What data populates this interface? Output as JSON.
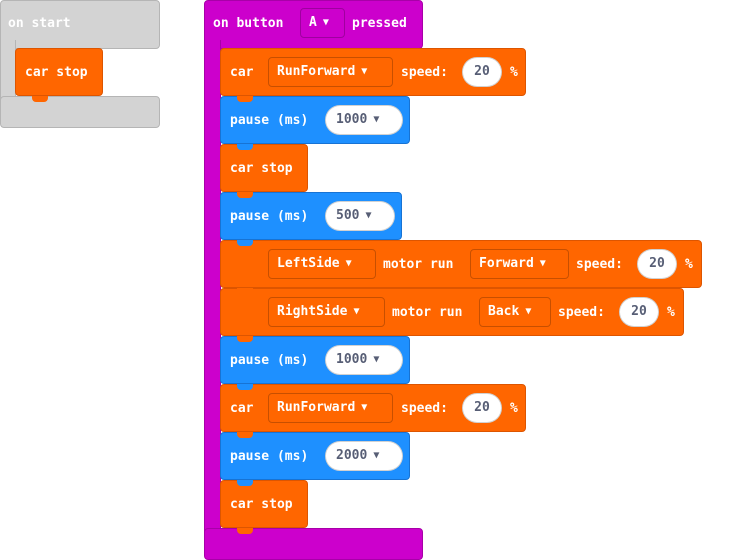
{
  "on_start": {
    "label": "on start",
    "blocks": [
      {
        "label": "car stop"
      }
    ]
  },
  "on_button": {
    "prefix": "on button",
    "button": "A",
    "suffix": "pressed"
  },
  "stack": {
    "b1": {
      "label": "car",
      "dropdown": "RunForward",
      "speed_label": "speed:",
      "speed": "20",
      "unit": "%"
    },
    "b2": {
      "label": "pause (ms)",
      "value": "1000"
    },
    "b3": {
      "label": "car stop"
    },
    "b4": {
      "label": "pause (ms)",
      "value": "500"
    },
    "b5": {
      "side": "LeftSide",
      "motor_label": "motor run",
      "direction": "Forward",
      "speed_label": "speed:",
      "speed": "20",
      "unit": "%"
    },
    "b6": {
      "side": "RightSide",
      "motor_label": "motor run",
      "direction": "Back",
      "speed_label": "speed:",
      "speed": "20",
      "unit": "%"
    },
    "b7": {
      "label": "pause (ms)",
      "value": "1000"
    },
    "b8": {
      "label": "car",
      "dropdown": "RunForward",
      "speed_label": "speed:",
      "speed": "20",
      "unit": "%"
    },
    "b9": {
      "label": "pause (ms)",
      "value": "2000"
    },
    "b10": {
      "label": "car stop"
    }
  },
  "caret_glyph": "▼",
  "colors": {
    "events": "#cc00cc",
    "car": "#ff6600",
    "basic": "#1e90ff",
    "disabled": "#d3d3d3"
  },
  "icons": [
    "dropdown-caret-icon"
  ]
}
